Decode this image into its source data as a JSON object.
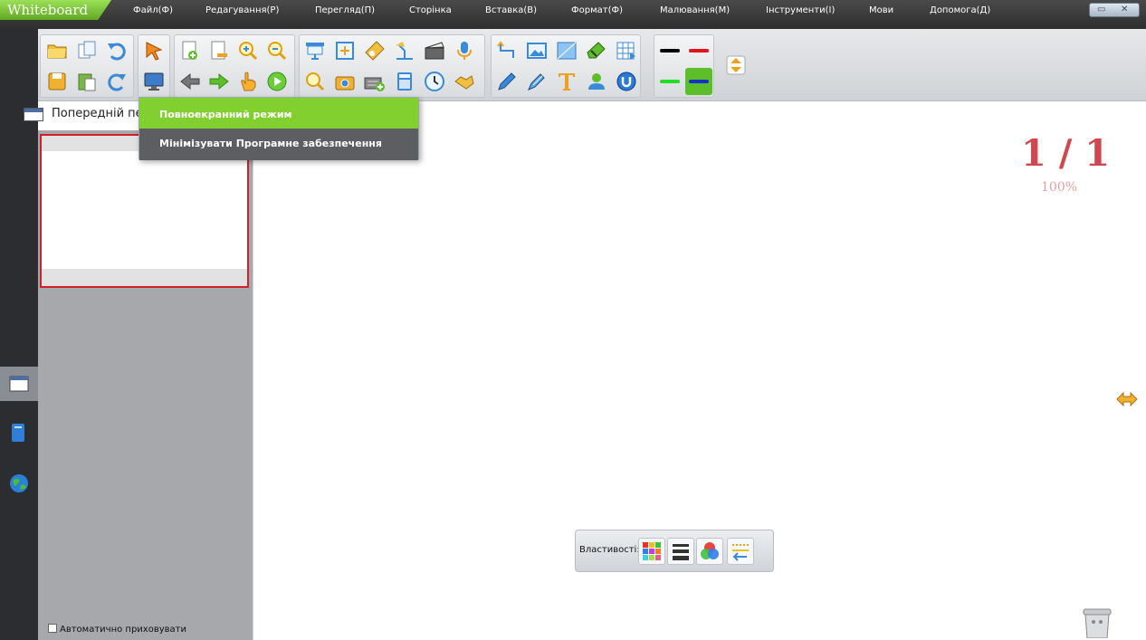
{
  "app": {
    "logo": "Whiteboard"
  },
  "menu": [
    "Файл(Ф)",
    "Редагування(Р)",
    "Перегляд(П)",
    "Сторінка",
    "Вставка(В)",
    "Формат(Ф)",
    "Малювання(М)",
    "Інструменти(І)",
    "Мови",
    "Допомога(Д)"
  ],
  "dropdown": {
    "items": [
      "Повноекранний режим",
      "Мінімізувати Програмне забезпечення"
    ],
    "highlight_color": "#82d02f"
  },
  "panel": {
    "previous_label": "Попередній пер",
    "autohide_label": "Автоматично приховувати"
  },
  "canvas": {
    "page_indicator": "1 / 1",
    "zoom": "100%",
    "page_color": "#d0474f"
  },
  "properties": {
    "label": "Властивості:"
  },
  "pen_colors": [
    "#000000",
    "#e0151b",
    "#22dd22",
    "#1431c8"
  ]
}
